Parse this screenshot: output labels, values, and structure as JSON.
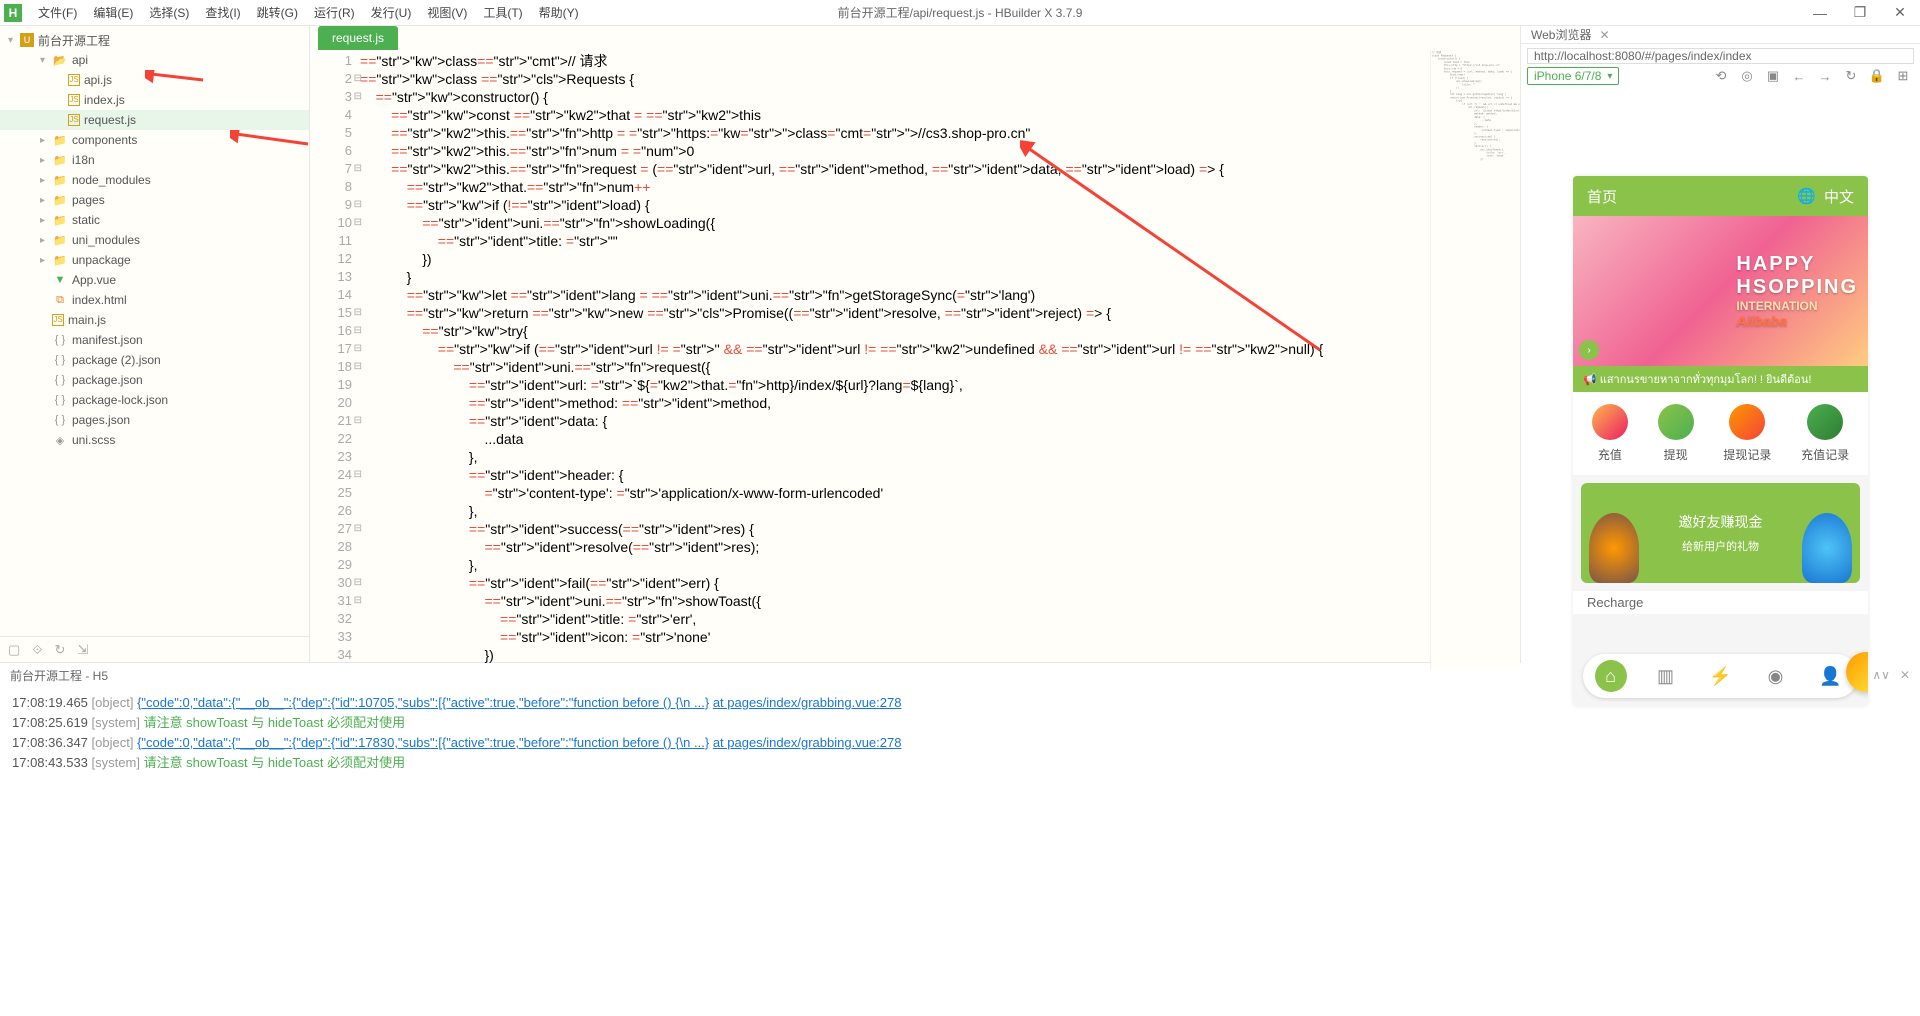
{
  "window": {
    "title": "前台开源工程/api/request.js - HBuilder X 3.7.9",
    "controls": {
      "min": "—",
      "max": "❐",
      "close": "✕"
    }
  },
  "menubar": [
    "文件(F)",
    "编辑(E)",
    "选择(S)",
    "查找(I)",
    "跳转(G)",
    "运行(R)",
    "发行(U)",
    "视图(V)",
    "工具(T)",
    "帮助(Y)"
  ],
  "sidebar": {
    "project": "前台开源工程",
    "items": [
      {
        "name": "api",
        "type": "folder",
        "open": true,
        "level": 2
      },
      {
        "name": "api.js",
        "type": "js",
        "level": 3
      },
      {
        "name": "index.js",
        "type": "js",
        "level": 3
      },
      {
        "name": "request.js",
        "type": "js",
        "level": 3,
        "selected": true
      },
      {
        "name": "components",
        "type": "folder",
        "level": 2
      },
      {
        "name": "i18n",
        "type": "folder",
        "level": 2
      },
      {
        "name": "node_modules",
        "type": "folder",
        "level": 2
      },
      {
        "name": "pages",
        "type": "folder",
        "level": 2
      },
      {
        "name": "static",
        "type": "folder",
        "level": 2
      },
      {
        "name": "uni_modules",
        "type": "folder",
        "level": 2
      },
      {
        "name": "unpackage",
        "type": "folder",
        "level": 2
      },
      {
        "name": "App.vue",
        "type": "vue",
        "level": 2
      },
      {
        "name": "index.html",
        "type": "html",
        "level": 2
      },
      {
        "name": "main.js",
        "type": "js",
        "level": 2
      },
      {
        "name": "manifest.json",
        "type": "json",
        "level": 2
      },
      {
        "name": "package (2).json",
        "type": "json",
        "level": 2
      },
      {
        "name": "package.json",
        "type": "json",
        "level": 2
      },
      {
        "name": "package-lock.json",
        "type": "json",
        "level": 2
      },
      {
        "name": "pages.json",
        "type": "json",
        "level": 2
      },
      {
        "name": "uni.scss",
        "type": "scss",
        "level": 2
      }
    ]
  },
  "tabs": {
    "active": "request.js"
  },
  "editor": {
    "lines": [
      "// 请求",
      "class Requests {",
      "    constructor() {",
      "        const that = this",
      "        this.http = \"https://cs3.shop-pro.cn\"",
      "        this.num = 0",
      "        this.request = (url, method, data, load) => {",
      "            that.num++",
      "            if (!load) {",
      "                uni.showLoading({",
      "                    title: \"\"",
      "                })",
      "            }",
      "            let lang = uni.getStorageSync('lang')",
      "            return new Promise((resolve, reject) => {",
      "                try{",
      "                    if (url != '' && url != undefined && url != null) {",
      "                        uni.request({",
      "                            url: `${that.http}/index/${url}?lang=${lang}`,",
      "                            method: method,",
      "                            data: {",
      "                                ...data",
      "                            },",
      "                            header: {",
      "                                'content-type': 'application/x-www-form-urlencoded'",
      "                            },",
      "                            success(res) {",
      "                                resolve(res);",
      "                            },",
      "                            fail(err) {",
      "                                uni.showToast({",
      "                                    title: 'err',",
      "                                    icon: 'none'",
      "                                })"
    ]
  },
  "browser": {
    "tab": "Web浏览器",
    "url": "http://localhost:8080/#/pages/index/index",
    "device": "iPhone 6/7/8"
  },
  "preview": {
    "headerTitle": "首页",
    "headerLang": "中文",
    "bannerLine1": "HAPPY",
    "bannerLine2": "HSOPPING",
    "bannerLine3": "INTERNATION",
    "bannerLine4": "Alibaba",
    "notice": "📢  แสากนรขายหาจากทั่วทุกมุมโลก! ! ยินดีต้อน!",
    "actions": [
      "充值",
      "提现",
      "提现记录",
      "充值记录"
    ],
    "promoTitle": "邀好友赚现金",
    "promoSub": "给新用户的礼物",
    "rechargeLabel": "Recharge"
  },
  "console": {
    "title": "前台开源工程 - H5",
    "logs": [
      {
        "ts": "17:08:19.465",
        "tag": "[object]",
        "body": "{\"code\":0,\"data\":{\"__ob__\":{\"dep\":{\"id\":10705,\"subs\":[{\"active\":true,\"before\":\"function before () {\\n       ...}",
        "link": "at pages/index/grabbing.vue:278"
      },
      {
        "ts": "17:08:25.619",
        "tag": "[system]",
        "warn": "请注意 showToast 与 hideToast 必须配对使用"
      },
      {
        "ts": "17:08:36.347",
        "tag": "[object]",
        "body": "{\"code\":0,\"data\":{\"__ob__\":{\"dep\":{\"id\":17830,\"subs\":[{\"active\":true,\"before\":\"function before () {\\n       ...}",
        "link": "at pages/index/grabbing.vue:278"
      },
      {
        "ts": "17:08:43.533",
        "tag": "[system]",
        "warn": "请注意 showToast 与 hideToast 必须配对使用"
      }
    ]
  }
}
